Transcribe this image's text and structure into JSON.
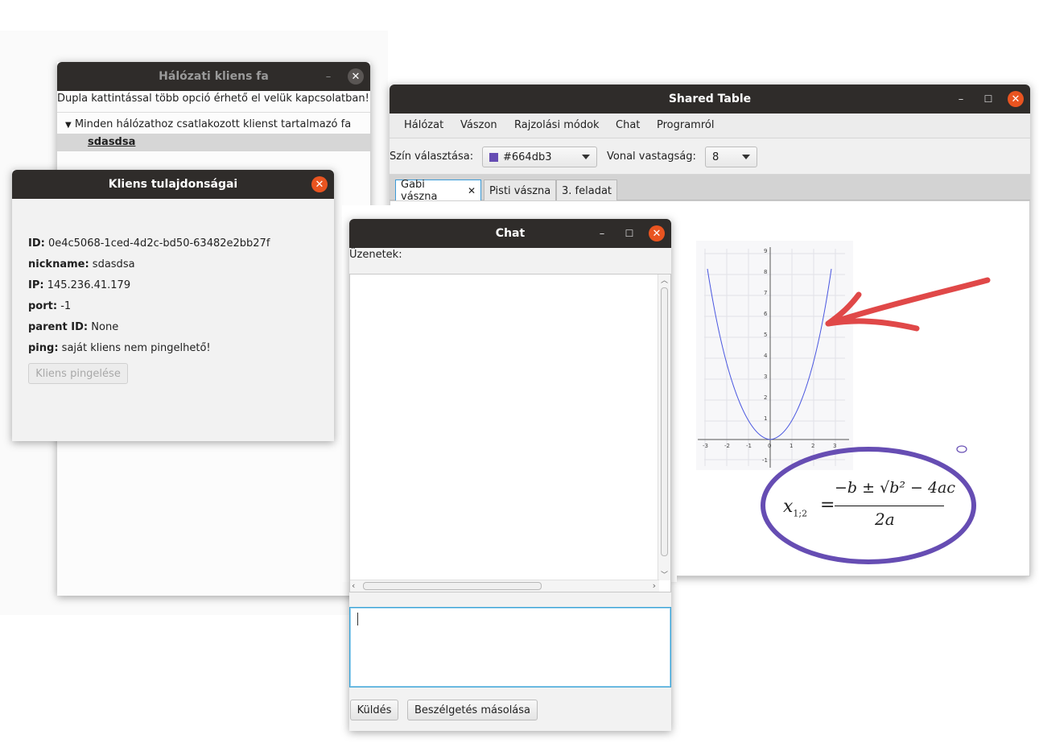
{
  "network_tree_window": {
    "title": "Hálózati kliens fa",
    "hint": "Dupla kattintással több opció érhető el velük kapcsolatban!",
    "root_label": "Minden hálózathoz csatlakozott klienst tartalmazó fa",
    "client_node": "sdasdsa"
  },
  "client_props_window": {
    "title": "Kliens tulajdonságai",
    "id_label": "ID:",
    "id_value": "0e4c5068-1ced-4d2c-bd50-63482e2bb27f",
    "nickname_label": "nickname:",
    "nickname_value": "sdasdsa",
    "ip_label": "IP:",
    "ip_value": "145.236.41.179",
    "port_label": "port:",
    "port_value": "-1",
    "parent_label": "parent ID:",
    "parent_value": "None",
    "ping_label": "ping:",
    "ping_value": "saját kliens nem pingelhető!",
    "ping_button": "Kliens pingelése"
  },
  "shared_table_window": {
    "title": "Shared Table",
    "menu": [
      "Hálózat",
      "Vászon",
      "Rajzolási módok",
      "Chat",
      "Programról"
    ],
    "color_label": "Szín választása:",
    "color_value": "#664db3",
    "width_label": "Vonal vastagság:",
    "width_value": "8",
    "tabs": [
      "Gabi vászna",
      "Pisti vászna",
      "3. feladat"
    ],
    "tab_close": "✕",
    "formula_lhs": "x",
    "formula_sub": "1;2",
    "formula_num": "−b ± √b² − 4ac",
    "formula_den": "2a",
    "graph_y_ticks": [
      "9",
      "8",
      "7",
      "6",
      "5",
      "4",
      "3",
      "2",
      "1",
      "-1"
    ],
    "graph_x_ticks": [
      "-3",
      "-2",
      "-1",
      "0",
      "1",
      "2",
      "3"
    ]
  },
  "chat_window": {
    "title": "Chat",
    "messages_label": "Üzenetek:",
    "send_button": "Küldés",
    "copy_button": "Beszélgetés másolása"
  },
  "colors": {
    "accent_orange": "#e95420",
    "titlebar": "#2f2c2a",
    "pen_purple": "#664db3",
    "pen_red": "#e04848"
  }
}
